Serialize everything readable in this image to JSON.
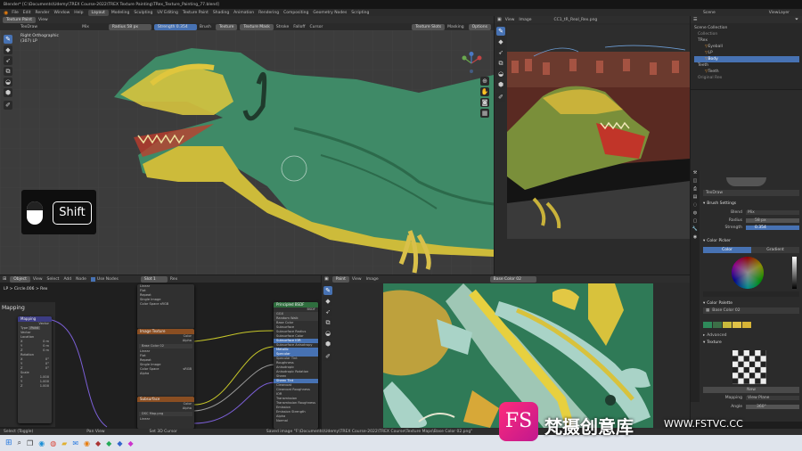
{
  "window_title": "Blender* [C:\\Documents\\Udemy\\TREX Course-2022\\TREX Texture Painting\\TRex_Texture_Painting_77.blend]",
  "menu": [
    "File",
    "Edit",
    "Render",
    "Window",
    "Help"
  ],
  "workspace_tabs": [
    "Layout",
    "Modeling",
    "Sculpting",
    "UV Editing",
    "Texture Paint",
    "Shading",
    "Animation",
    "Rendering",
    "Compositing",
    "Geometry Nodes",
    "Scripting"
  ],
  "active_workspace": "Layout",
  "scene_name": "Scene",
  "view_layer": "ViewLayer",
  "viewport": {
    "mode": "Texture Paint",
    "view_menu": "View",
    "brush_name": "TexDraw",
    "blend_mode": "Mix",
    "radius_label": "Radius",
    "radius_value": "58 px",
    "strength_label": "Strength",
    "strength_value": "0.354",
    "header_menus": [
      "Brush",
      "Texture",
      "Texture Mask",
      "Stroke",
      "Falloff",
      "Cursor"
    ],
    "texture_slots": "Texture Slots",
    "masking": "Masking",
    "options": "Options",
    "view_name": "Right Orthographic",
    "object_name": "(307) LP"
  },
  "keycast": {
    "key": "Shift"
  },
  "image_editor": {
    "mode": "Paint",
    "menus": [
      "View",
      "Image"
    ],
    "image_name": "CC1_tR_Real_Rex.png"
  },
  "outliner": {
    "header": "Scene Collection",
    "items": [
      "Collection",
      "TRex",
      "Eyeball",
      "LP",
      "Body",
      "Teeth",
      "Teeth",
      "Original Rex"
    ]
  },
  "properties": {
    "brush": "TexDraw",
    "brush_settings": "Brush Settings",
    "blend_label": "Blend",
    "blend_value": "Mix",
    "radius_label": "Radius",
    "radius_value": "58 px",
    "strength_label": "Strength",
    "strength_value": "0.354",
    "color_picker": "Color Picker",
    "color_tab": "Color",
    "gradient_tab": "Gradient",
    "color_palette": "Color Palette",
    "palette_name": "Base Color 02",
    "advanced": "Advanced",
    "texture": "Texture",
    "texture_new": "New",
    "mapping_label": "Mapping",
    "mapping_value": "View Plane",
    "angle_label": "Angle",
    "angle_value": "360°",
    "swatches": [
      "#2e8a5a",
      "#3c6f47",
      "#c9bb3c",
      "#e0c247",
      "#d7b436"
    ]
  },
  "node_editor": {
    "header_items": [
      "Object",
      "View",
      "Select",
      "Add",
      "Node",
      "Use Nodes",
      "Slot 1",
      "Rex"
    ],
    "breadcrumb": "LP  >  Circle.006  >  Rex",
    "left_panel_title": "Mapping",
    "mapping_rows": [
      "Vector",
      "Type",
      "Point",
      "Vector",
      "Location",
      "X",
      "Y",
      "Z",
      "Rotation",
      "X",
      "Y",
      "Z",
      "Scale",
      "X",
      "Y",
      "Z"
    ],
    "mapping_values": [
      "0 m",
      "0 m",
      "0 m",
      "0°",
      "0°",
      "0°",
      "1.000",
      "1.000",
      "1.000"
    ],
    "nodes": {
      "image1": {
        "title": "Base Color 02",
        "rows": [
          "Color",
          "Alpha",
          "Linear",
          "Flat",
          "Repeat",
          "Single Image",
          "Color Space",
          "sRGB",
          "Alpha"
        ]
      },
      "image2": {
        "title": "Subsurface",
        "rows": [
          "Color",
          "Alpha",
          "Linear",
          "Flat",
          "Repeat",
          "Single Image",
          "Color Space",
          "sRGB"
        ]
      },
      "image3": {
        "title": "DSC Map.png",
        "rows": [
          "Color",
          "Alpha"
        ]
      },
      "bsdf": {
        "title": "Principled BSDF",
        "rows": [
          "BSDF",
          "GGX",
          "Random Walk",
          "Base Color",
          "Subsurface",
          "Subsurface Radius",
          "Subsurface Color",
          "Subsurface IOR",
          "Subsurface Anisotropy",
          "Metallic",
          "Specular",
          "Specular Tint",
          "Roughness",
          "Anisotropic",
          "Anisotropic Rotation",
          "Sheen",
          "Sheen Tint",
          "Clearcoat",
          "Clearcoat Roughness",
          "IOR",
          "Transmission",
          "Transmission Roughness",
          "Emission",
          "Emission Strength",
          "Alpha",
          "Normal"
        ]
      },
      "frame": {
        "rows": [
          "Linear",
          "Flat",
          "Repeat",
          "Single Image",
          "Color Space",
          "sRGB"
        ]
      }
    }
  },
  "uv_editor": {
    "mode": "Paint",
    "menus": [
      "View",
      "Image"
    ],
    "image_name": "Base Color 02"
  },
  "status_bar": {
    "left": "Select (Toggle)",
    "mid": "Pan View",
    "right": "Set 3D Cursor",
    "message": "Saved image \"F:\\Documents\\Udemy\\TREX Course-2022\\TREX Course\\Texture Maps\\Base Color 02.png\""
  },
  "watermark": {
    "logo": "FS",
    "text": "梵摄创意库",
    "url": "WWW.FSTVC.CC"
  }
}
